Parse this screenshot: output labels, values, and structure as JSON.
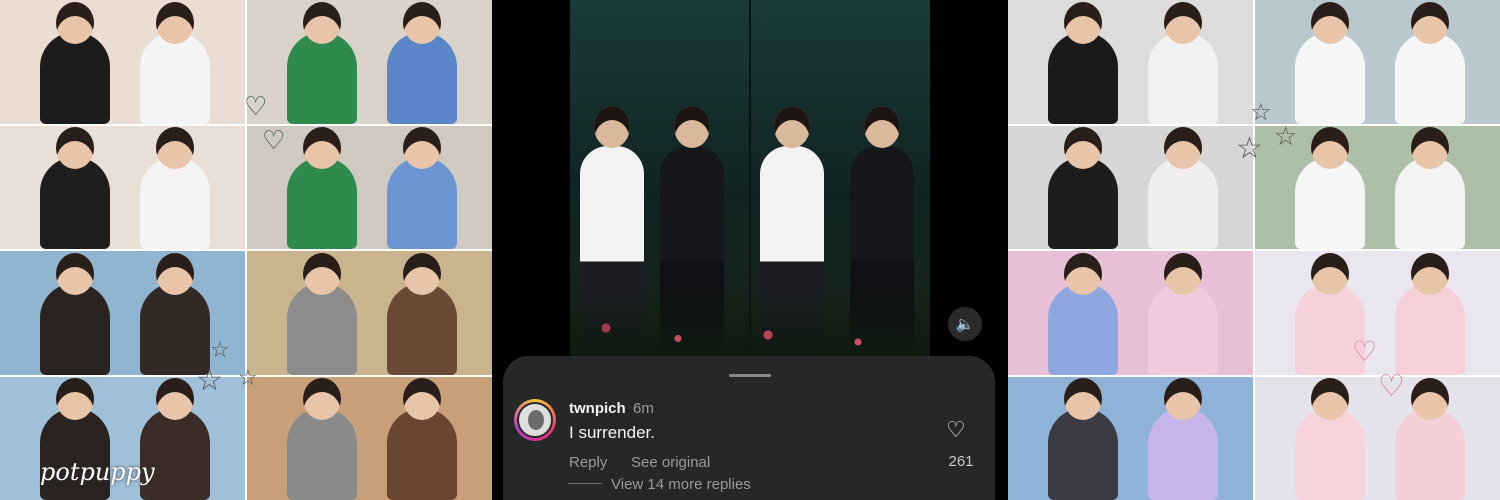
{
  "left_collage": {
    "signature": "potpuppy",
    "tiles": [
      {
        "name": "photo-duo-white-shirts",
        "bg": "#e9ddd4",
        "figs": [
          "#1c1c1c",
          "#f4f4f4"
        ]
      },
      {
        "name": "photo-duo-classroom",
        "bg": "#d8d2c8",
        "figs": [
          "#2f8a4e",
          "#5a86c9"
        ]
      },
      {
        "name": "photo-duo-smiling",
        "bg": "#eadfd6",
        "figs": [
          "#1e1e1e",
          "#f3f3f3"
        ]
      },
      {
        "name": "photo-duo-laughing",
        "bg": "#cfc9bf",
        "figs": [
          "#2f8a4e",
          "#6b94d2"
        ]
      },
      {
        "name": "photo-duo-leather-jackets",
        "bg": "#8fb5d0",
        "figs": [
          "#2a2320",
          "#332a26"
        ]
      },
      {
        "name": "photo-duo-microphones",
        "bg": "#c9b48e",
        "figs": [
          "#8c8c8c",
          "#6b4a35"
        ]
      },
      {
        "name": "photo-duo-stage",
        "bg": "#9fc0d8",
        "figs": [
          "#2a2320",
          "#3a2d27"
        ]
      },
      {
        "name": "photo-duo-event",
        "bg": "#c7a07a",
        "figs": [
          "#8a8a8a",
          "#6a4632"
        ]
      }
    ]
  },
  "right_collage": {
    "tiles": [
      {
        "name": "photo-duo-livestream",
        "bg": "#dcdcdc",
        "figs": [
          "#1a1a1a",
          "#f1f1f1"
        ]
      },
      {
        "name": "photo-duo-outdoor",
        "bg": "#b9c7cf",
        "figs": [
          "#f6f6f6",
          "#f6f6f6"
        ]
      },
      {
        "name": "photo-duo-livestream-laugh",
        "bg": "#d6d6d6",
        "figs": [
          "#1d1d1d",
          "#efefef"
        ]
      },
      {
        "name": "photo-duo-outdoor-close",
        "bg": "#aebfa8",
        "figs": [
          "#f6f6f6",
          "#f3f3f3"
        ]
      },
      {
        "name": "photo-duo-pink-set",
        "bg": "#e7bfd6",
        "figs": [
          "#8fa7e0",
          "#f2c9de"
        ]
      },
      {
        "name": "photo-duo-pink-shirts",
        "bg": "#e9e6ef",
        "figs": [
          "#f5d2da",
          "#f5d0d8"
        ]
      },
      {
        "name": "photo-duo-bouquet",
        "bg": "#8fb2d9",
        "figs": [
          "#3b3b44",
          "#c6b5e8"
        ]
      },
      {
        "name": "photo-duo-pink-shirts-close",
        "bg": "#e4e2ea",
        "figs": [
          "#f6d3db",
          "#f4cfd8"
        ]
      }
    ]
  },
  "video": {
    "mute_icon": "speaker-icon"
  },
  "comment": {
    "username": "twnpich",
    "time": "6m",
    "text": "I surrender.",
    "reply_label": "Reply",
    "see_original_label": "See original",
    "like_count": "261",
    "view_replies_label": "View 14 more replies"
  }
}
